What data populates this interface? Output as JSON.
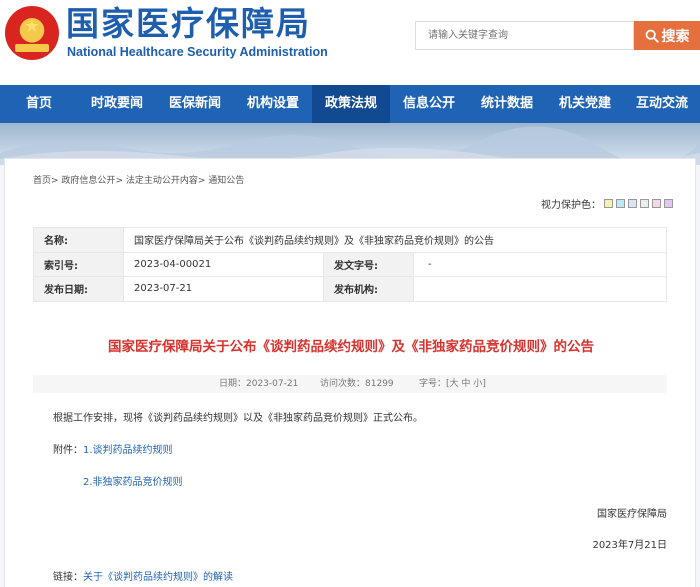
{
  "header": {
    "title_cn": "国家医疗保障局",
    "title_en": "National Healthcare Security Administration",
    "search_placeholder": "请输入关键字查询",
    "search_button": "搜索"
  },
  "nav": {
    "items": [
      {
        "label": "首页"
      },
      {
        "label": "时政要闻"
      },
      {
        "label": "医保新闻"
      },
      {
        "label": "机构设置"
      },
      {
        "label": "政策法规"
      },
      {
        "label": "信息公开"
      },
      {
        "label": "统计数据"
      },
      {
        "label": "机关党建"
      },
      {
        "label": "互动交流"
      }
    ],
    "active": "政策法规"
  },
  "breadcrumb": [
    "首页",
    "政府信息公开",
    "法定主动公开内容",
    "通知公告"
  ],
  "eye_care": {
    "label": "视力保护色：",
    "colors": [
      "#f7f1b2",
      "#bfe8f6",
      "#dbe4f3",
      "#ececec",
      "#f6d7e9",
      "#e0c8f2"
    ]
  },
  "meta": {
    "name_label": "名称:",
    "name_value": "国家医疗保障局关于公布《谈判药品续约规则》及《非独家药品竞价规则》的公告",
    "index_label": "索引号:",
    "index_value": "2023-04-00021",
    "doc_no_label": "发文字号:",
    "doc_no_value": "-",
    "date_label": "发布日期:",
    "date_value": "2023-07-21",
    "org_label": "发布机构:",
    "org_value": ""
  },
  "article": {
    "title": "国家医疗保障局关于公布《谈判药品续约规则》及《非独家药品竞价规则》的公告",
    "date_text": "日期：2023-07-21",
    "visits_label": "访问次数：",
    "visits_value": "81299",
    "font_label": "字号：[",
    "font_large": "大",
    "font_medium": "中",
    "font_small": "小",
    "font_end": "]",
    "body": "根据工作安排，现将《谈判药品续约规则》以及《非独家药品竞价规则》正式公布。",
    "attachment_label": "附件：",
    "attachment_1": "1.谈判药品续约规则",
    "attachment_2": "2.非独家药品竞价规则",
    "signature": "国家医疗保障局",
    "sign_date": "2023年7月21日",
    "related_label": "链接：",
    "related_link": "关于《谈判药品续约规则》的解读"
  }
}
